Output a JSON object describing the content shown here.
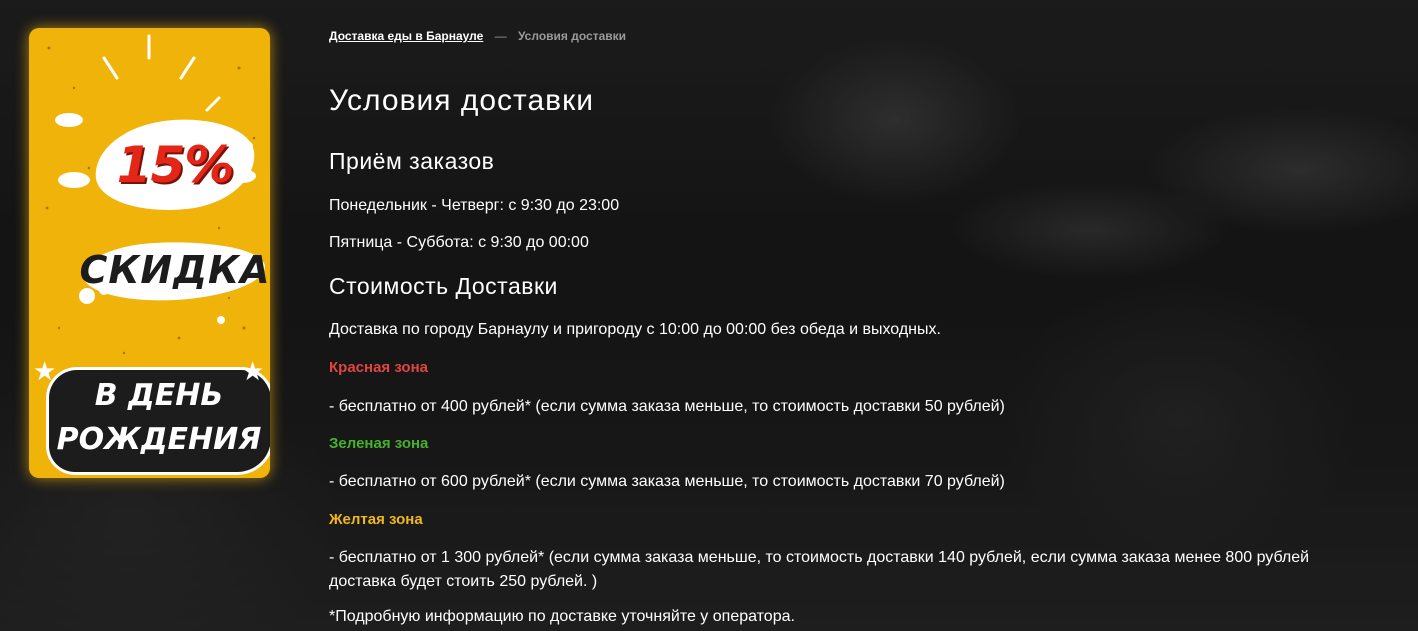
{
  "colors": {
    "promo_bg": "#f0b30a",
    "zone_red": "#e0453f",
    "zone_green": "#46b12a",
    "zone_yellow": "#f1b71d",
    "breadcrumb_muted": "#9a9a9a"
  },
  "promo": {
    "percent": "15%",
    "sale": "СКИДКА",
    "line1": "В ДЕНЬ",
    "line2": "РОЖДЕНИЯ"
  },
  "breadcrumb": {
    "home": "Доставка еды в Барнауле",
    "separator": "—",
    "current": "Условия доставки"
  },
  "page": {
    "title": "Условия доставки",
    "orders_heading": "Приём заказов",
    "hours_1": "Понедельник - Четверг: с 9:30 до 23:00",
    "hours_2": "Пятница - Суббота: с 9:30 до 00:00",
    "cost_heading": "Стоимость Доставки",
    "delivery_info": "Доставка по городу Барнаулу и пригороду с 10:00 до 00:00 без обеда и выходных.",
    "zones": [
      {
        "name": "Красная зона",
        "text": "- бесплатно от 400 рублей* (если сумма заказа меньше, то стоимость доставки 50 рублей)"
      },
      {
        "name": "Зеленая зона",
        "text": "- бесплатно от 600 рублей* (если сумма заказа меньше, то стоимость доставки 70 рублей)"
      },
      {
        "name": "Желтая зона",
        "text": "- бесплатно от 1 300 рублей* (если сумма заказа меньше, то стоимость доставки 140 рублей, если сумма заказа менее 800 рублей доставка будет стоить 250 рублей. )"
      }
    ],
    "footnote": "*Подробную информацию по доставке уточняйте у оператора."
  }
}
